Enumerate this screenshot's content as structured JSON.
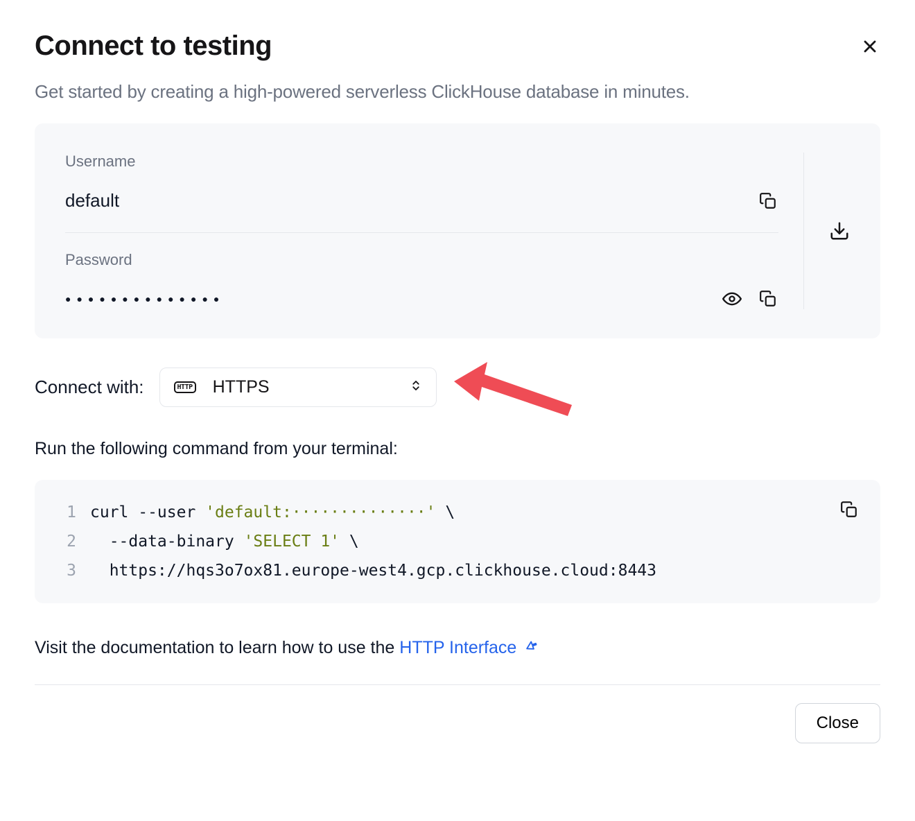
{
  "header": {
    "title": "Connect to testing",
    "subtitle": "Get started by creating a high-powered serverless ClickHouse database in minutes."
  },
  "credentials": {
    "username_label": "Username",
    "username_value": "default",
    "password_label": "Password",
    "password_masked": "●●●●●●●●●●●●●●"
  },
  "connect": {
    "label": "Connect with:",
    "selected": "HTTPS"
  },
  "instruction": "Run the following command from your terminal:",
  "code": {
    "lines": [
      {
        "n": "1",
        "pre": "curl --user ",
        "str": "'default:··············'",
        "post": " \\"
      },
      {
        "n": "2",
        "pre": "  --data-binary ",
        "str": "'SELECT 1'",
        "post": " \\"
      },
      {
        "n": "3",
        "pre": "  https://hqs3o7ox81.europe-west4.gcp.clickhouse.cloud:8443",
        "str": "",
        "post": ""
      }
    ]
  },
  "docs": {
    "prefix": "Visit the documentation to learn how to use the ",
    "link_text": "HTTP Interface"
  },
  "footer": {
    "close": "Close"
  }
}
